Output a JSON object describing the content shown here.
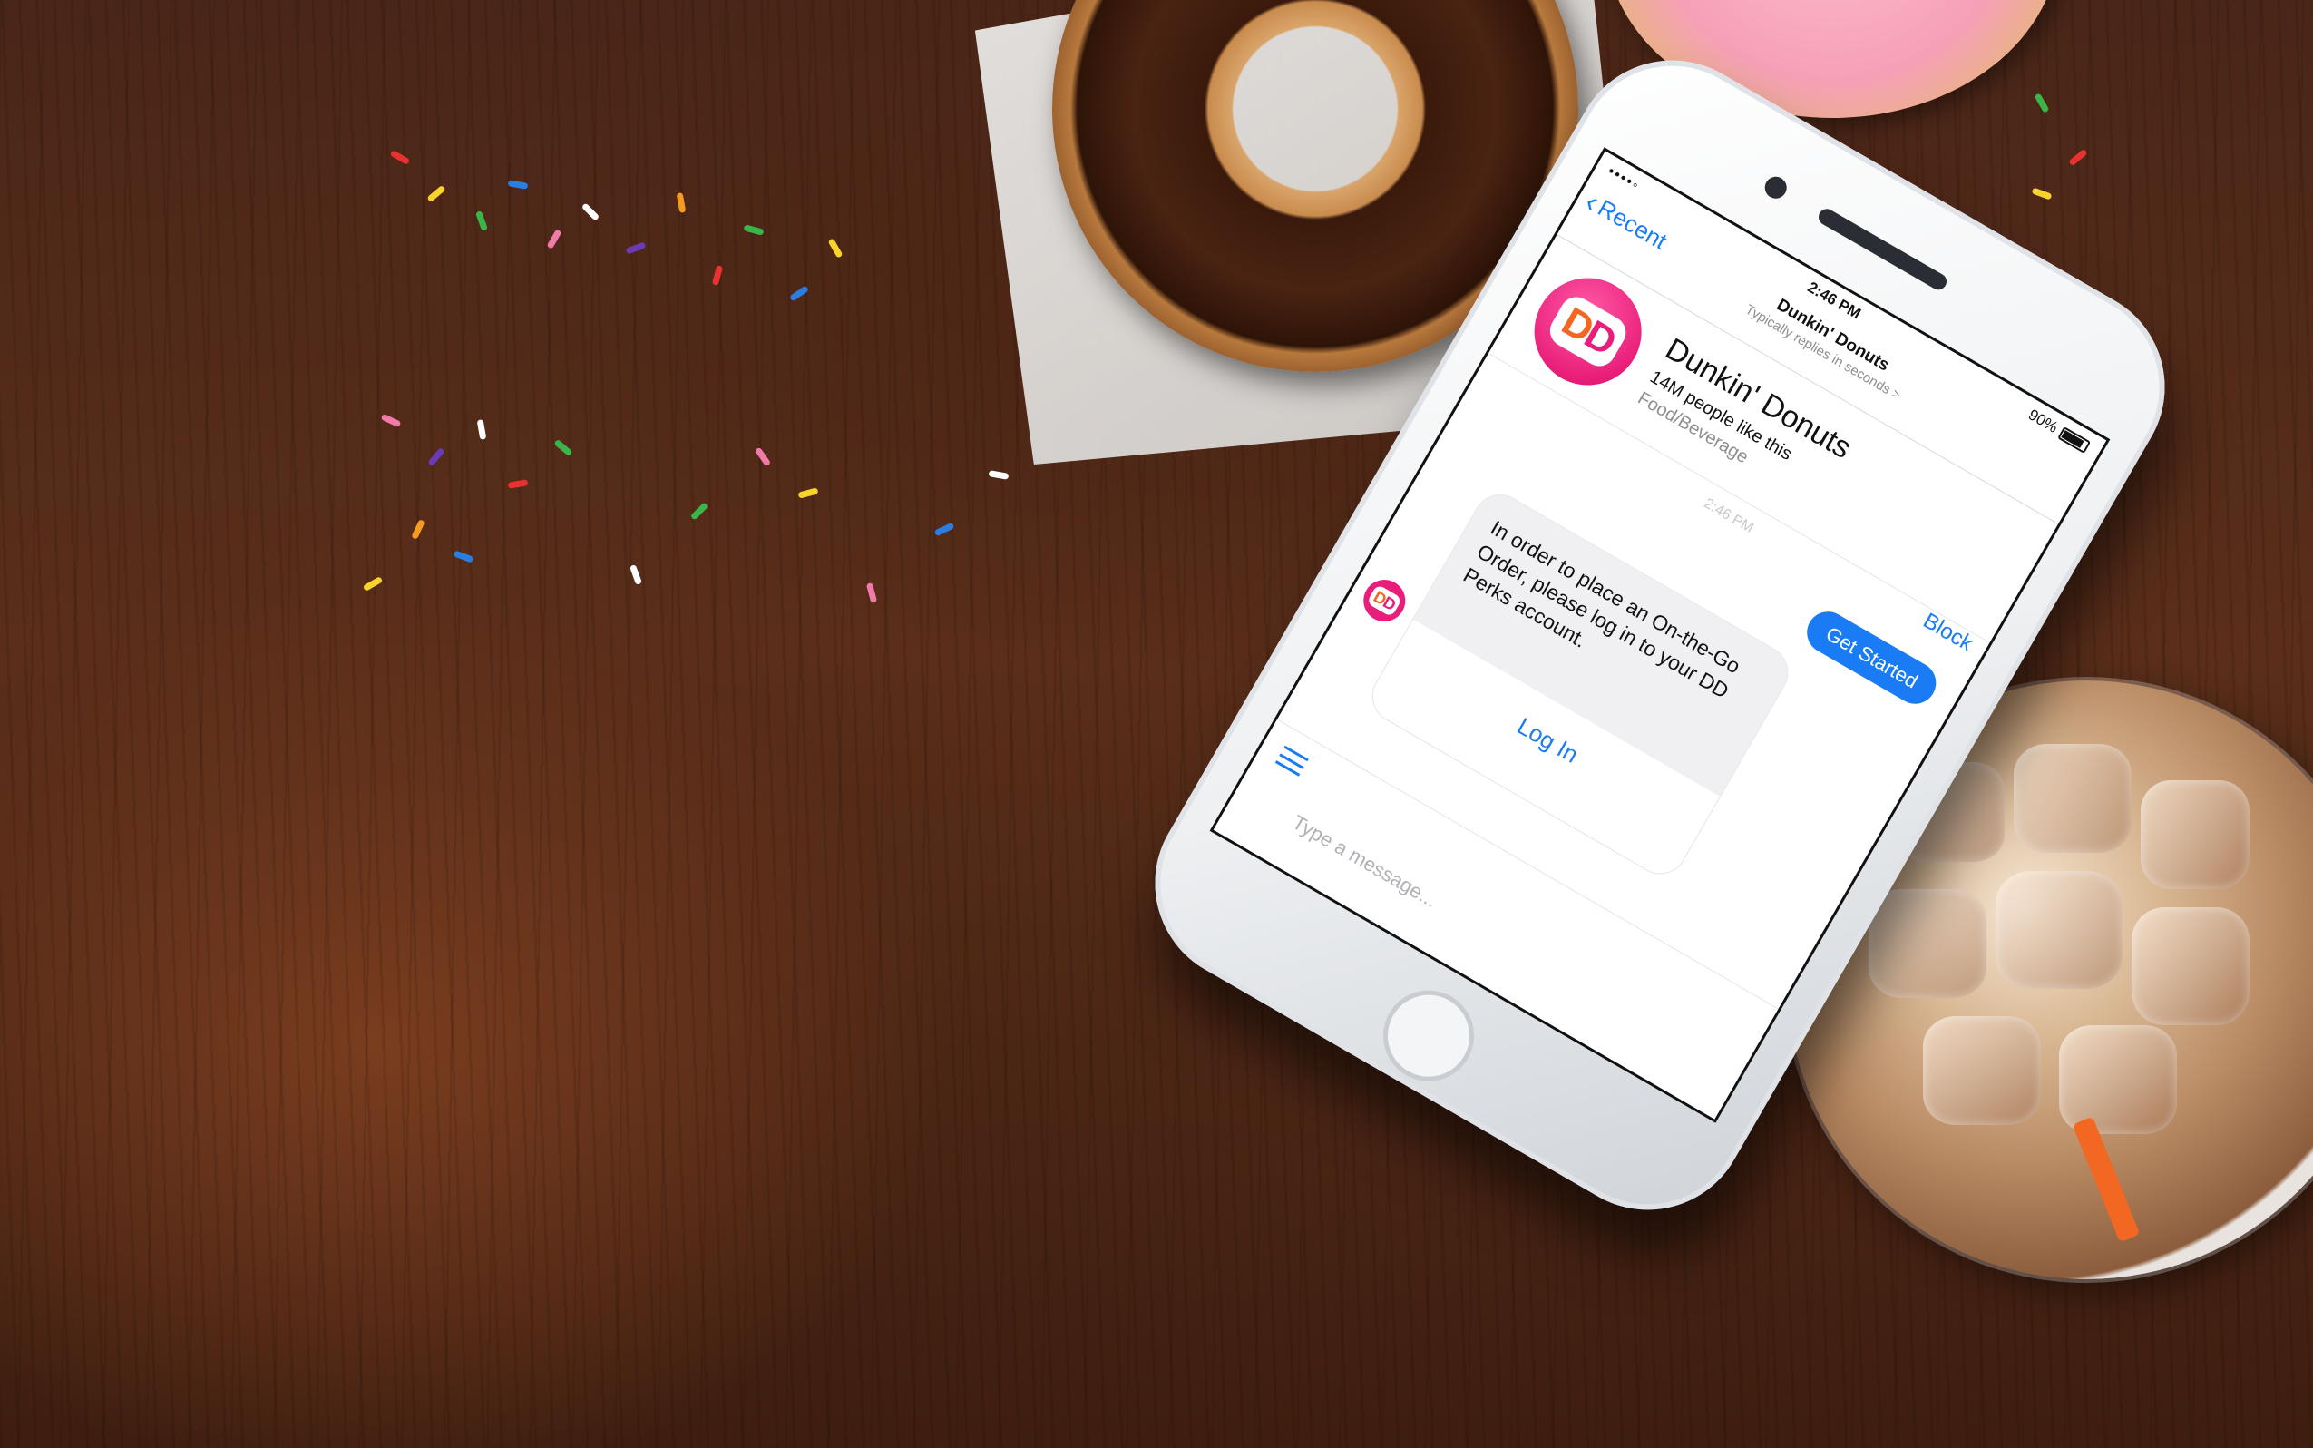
{
  "status_bar": {
    "signal": "••••◦",
    "time": "2:46 PM",
    "battery": "90%"
  },
  "nav": {
    "back_label": "Recent",
    "title": "Dunkin' Donuts",
    "subtitle": "Typically replies in seconds",
    "subtitle_chevron": ">",
    "block_label": "Block"
  },
  "page": {
    "logo_text_d1": "D",
    "logo_text_d2": "D",
    "name": "Dunkin' Donuts",
    "likes": "14M people like this",
    "category": "Food/Beverage"
  },
  "messages": {
    "timestamp": "2:46 PM",
    "get_started_label": "Get Started",
    "bot_text": "In order to place an On-the-Go Order, please log in to your DD Perks account.",
    "login_label": "Log In"
  },
  "composer": {
    "placeholder": "Type a message..."
  },
  "colors": {
    "accent": "#1a7cf5",
    "brand_pink": "#e91e7a",
    "brand_orange": "#f26722"
  },
  "icons": {
    "back": "chevron-left-icon",
    "menu": "menu-icon",
    "battery": "battery-icon"
  }
}
